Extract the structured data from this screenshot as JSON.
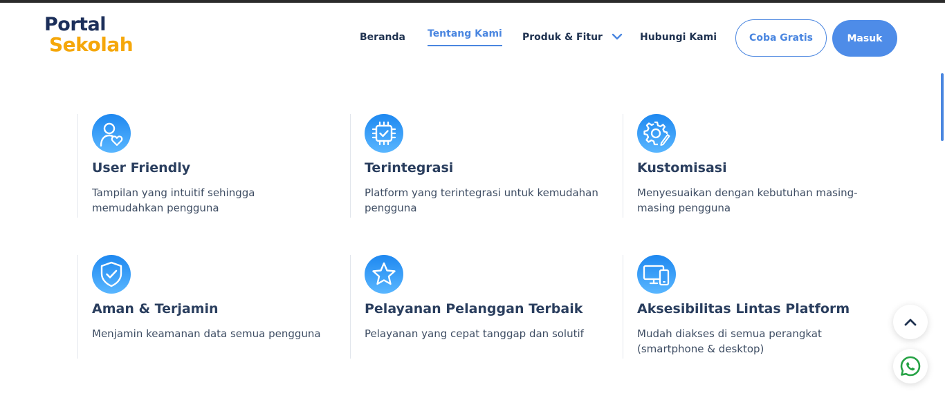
{
  "brand": {
    "name_line1": "Portal",
    "name_line2": "Sekolah"
  },
  "nav": {
    "items": [
      {
        "label": "Beranda"
      },
      {
        "label": "Tentang Kami",
        "active": true
      },
      {
        "label": "Produk & Fitur",
        "has_dropdown": true
      },
      {
        "label": "Hubungi Kami"
      }
    ],
    "cta_secondary": "Coba Gratis",
    "cta_primary": "Masuk"
  },
  "features": [
    {
      "icon": "user-heart-icon",
      "title": "User Friendly",
      "description": "Tampilan yang intuitif sehingga memudahkan pengguna"
    },
    {
      "icon": "chip-check-icon",
      "title": "Terintegrasi",
      "description": "Platform yang terintegrasi untuk kemudahan pengguna"
    },
    {
      "icon": "gear-pencil-icon",
      "title": "Kustomisasi",
      "description": "Menyesuaikan dengan kebutuhan masing-masing pengguna"
    },
    {
      "icon": "shield-check-icon",
      "title": "Aman & Terjamin",
      "description": "Menjamin keamanan data semua pengguna"
    },
    {
      "icon": "star-icon",
      "title": "Pelayanan Pelanggan Terbaik",
      "description": "Pelayanan yang cepat tanggap dan solutif"
    },
    {
      "icon": "devices-icon",
      "title": "Aksesibilitas Lintas Platform",
      "description": "Mudah diakses di semua perangkat (smartphone & desktop)"
    }
  ],
  "floating": {
    "scroll_top_icon": "chevron-up-icon",
    "chat_icon": "whatsapp-icon"
  },
  "colors": {
    "accent": "#4a86e0",
    "brand_dark": "#1c2f5a",
    "brand_yellow": "#f5a70a",
    "whatsapp": "#25a244"
  }
}
